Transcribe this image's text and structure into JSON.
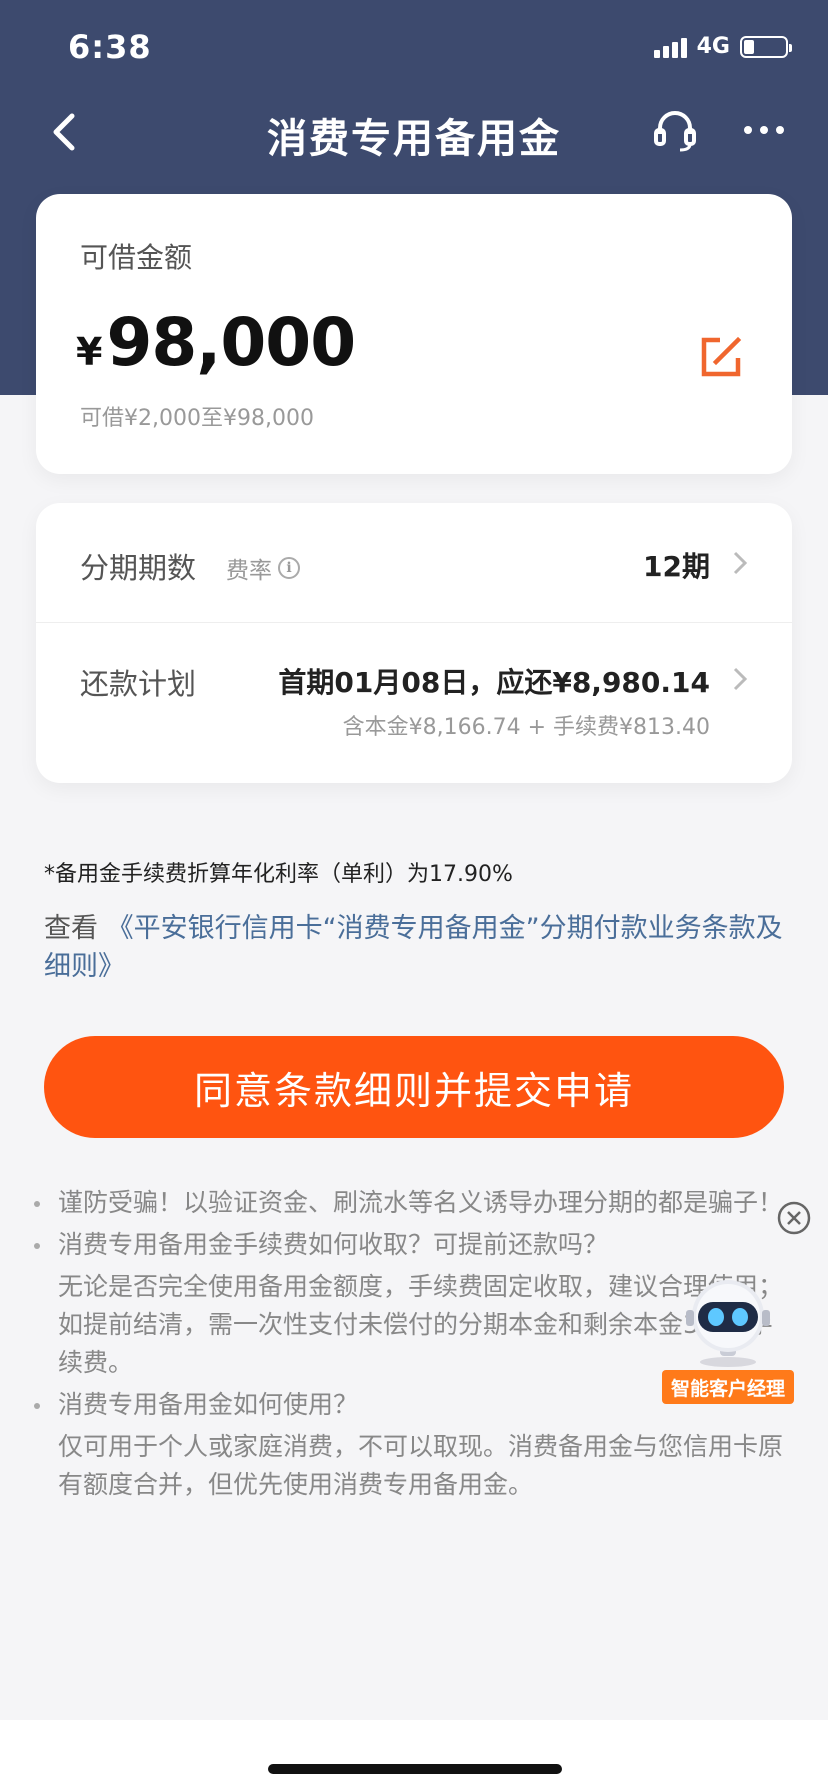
{
  "status_bar": {
    "time": "6:38",
    "network": "4G"
  },
  "nav": {
    "title": "消费专用备用金",
    "back_icon": "chevron-left-icon",
    "support_icon": "headset-icon",
    "more_icon": "more-dots-icon"
  },
  "amount_card": {
    "label": "可借金额",
    "currency": "¥",
    "amount": "98,000",
    "range": "可借¥2,000至¥98,000",
    "edit_icon": "edit-icon",
    "edit_color": "#f0662e"
  },
  "plan_card": {
    "installments_label": "分期期数",
    "fee_label": "费率",
    "installments_value": "12期",
    "repay_label": "还款计划",
    "repay_main": "首期01月08日，应还¥8,980.14",
    "repay_sub": "含本金¥8,166.74 + 手续费¥813.40"
  },
  "apr_note": "*备用金手续费折算年化利率（单利）为17.90%",
  "terms": {
    "prefix": "查看 ",
    "link": "《平安银行信用卡“消费专用备用金”分期付款业务条款及细则》"
  },
  "submit_button": {
    "label": "同意条款细则并提交申请",
    "color": "#ff5410"
  },
  "faq": [
    {
      "question": "谨防受骗！以验证资金、刷流水等名义诱导办理分期的都是骗子！",
      "answer": ""
    },
    {
      "question": "消费专用备用金手续费如何收取？可提前还款吗？",
      "answer": "无论是否完全使用备用金额度，手续费固定收取，建议合理使用；如提前结清，需一次性支付未偿付的分期本金和剩余本金3%的手续费。"
    },
    {
      "question": "消费专用备用金如何使用？",
      "answer": "仅可用于个人或家庭消费，不可以取现。消费备用金与您信用卡原有额度合并，但优先使用消费专用备用金。"
    }
  ],
  "assistant": {
    "label": "智能客户经理",
    "close_icon": "close-circle-icon"
  },
  "colors": {
    "header_bg": "#3d4a6e",
    "accent": "#ff5410",
    "link": "#4a6e99"
  }
}
